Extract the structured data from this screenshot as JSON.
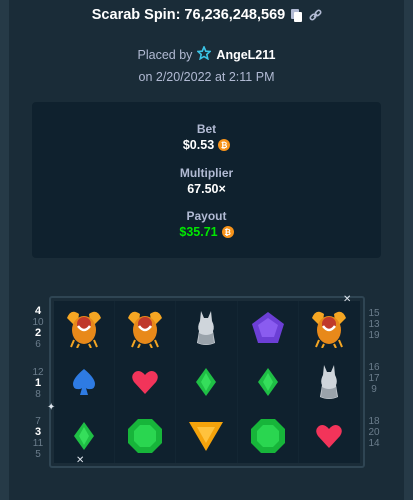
{
  "header": {
    "title": "Scarab Spin: 76,236,248,569",
    "copy_icon": "copy-icon",
    "link_icon": "link-icon"
  },
  "placed": {
    "prefix": "Placed by",
    "user": "AngeL211",
    "badge_icon": "star-badge-icon",
    "date": "on 2/20/2022 at 2:11 PM"
  },
  "stats": {
    "bet_label": "Bet",
    "bet_value": "$0.53",
    "multiplier_label": "Multiplier",
    "multiplier_value": "67.50×",
    "payout_label": "Payout",
    "payout_value": "$35.71",
    "currency_icon": "bitcoin-icon",
    "currency_glyph": "₿",
    "payout_color": "#00e701"
  },
  "paylines_left": [
    {
      "numbers": [
        "4",
        "10",
        "2",
        "6"
      ],
      "highlight": [
        "4",
        "2"
      ]
    },
    {
      "numbers": [
        "12",
        "1",
        "8"
      ],
      "highlight": [
        "1"
      ]
    },
    {
      "numbers": [
        "7",
        "3",
        "11",
        "5"
      ],
      "highlight": [
        "3"
      ]
    }
  ],
  "paylines_right": [
    {
      "numbers": [
        "15",
        "13",
        "19"
      ]
    },
    {
      "numbers": [
        "16",
        "17",
        "9"
      ]
    },
    {
      "numbers": [
        "18",
        "20",
        "14"
      ]
    }
  ],
  "reels": [
    [
      "scarab",
      "scarab",
      "cat",
      "pentagon-gem",
      "scarab"
    ],
    [
      "spade",
      "heart",
      "diamond-green",
      "diamond-green",
      "cat"
    ],
    [
      "diamond-green",
      "emerald",
      "triangle-gem",
      "emerald",
      "heart"
    ]
  ]
}
